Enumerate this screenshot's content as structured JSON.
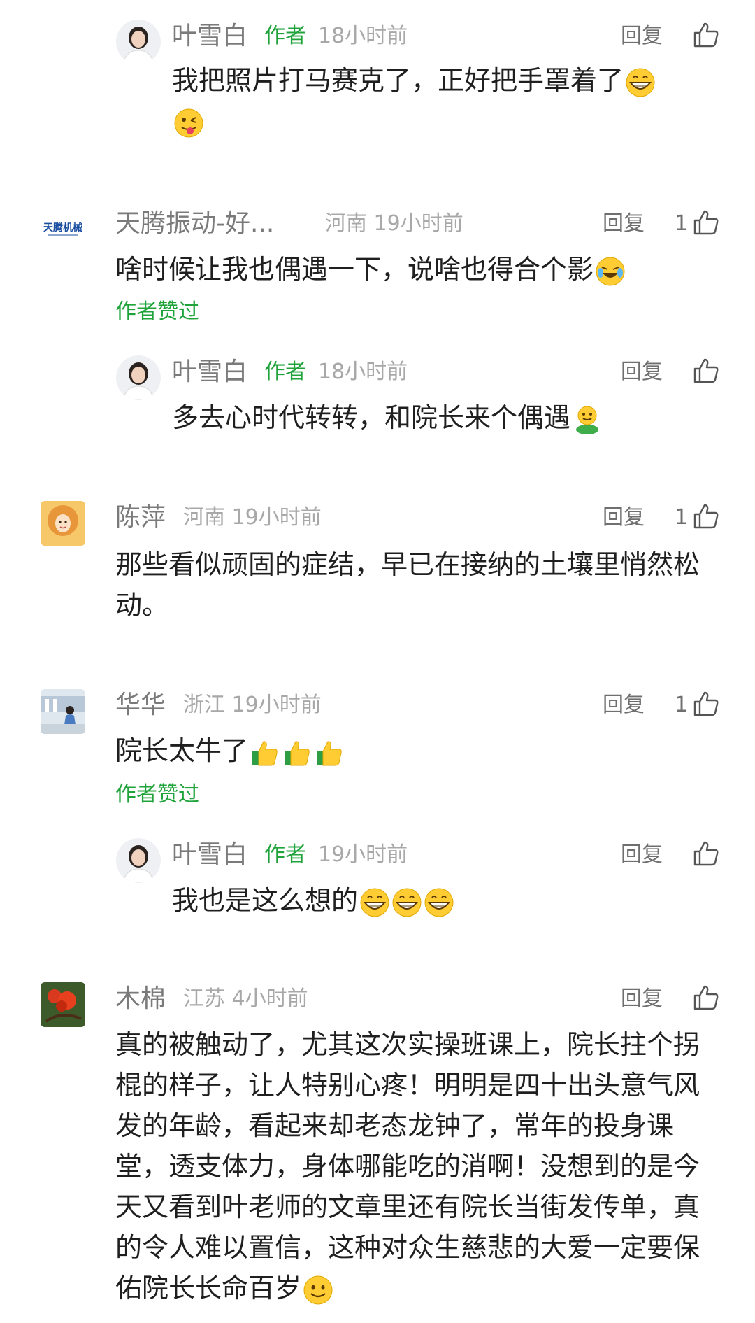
{
  "comments": [
    {
      "name": "叶雪白",
      "author_tag": "作者",
      "meta": "18小时前",
      "reply": "回复",
      "text": "我把照片打马赛克了，正好把手罩着了",
      "emojis": [
        "grin-emoji",
        "wink-tongue-emoji"
      ]
    },
    {
      "name": "天腾振动-好...",
      "meta": "河南 19小时前",
      "reply": "回复",
      "likes": "1",
      "text": "啥时候让我也偶遇一下，说啥也得合个影",
      "emojis": [
        "laugh-cry-emoji"
      ],
      "liked_by_author": "作者赞过"
    },
    {
      "name": "叶雪白",
      "author_tag": "作者",
      "meta": "18小时前",
      "reply": "回复",
      "text": "多去心时代转转，和院长来个偶遇",
      "emojis": [
        "hug-emoji"
      ]
    },
    {
      "name": "陈萍",
      "meta": "河南 19小时前",
      "reply": "回复",
      "likes": "1",
      "text": "那些看似顽固的症结，早已在接纳的土壤里悄然松动。"
    },
    {
      "name": "华华",
      "meta": "浙江 19小时前",
      "reply": "回复",
      "likes": "1",
      "text": "院长太牛了",
      "emojis": [
        "thumbs-up-emoji",
        "thumbs-up-emoji",
        "thumbs-up-emoji"
      ],
      "liked_by_author": "作者赞过"
    },
    {
      "name": "叶雪白",
      "author_tag": "作者",
      "meta": "19小时前",
      "reply": "回复",
      "text": "我也是这么想的",
      "emojis": [
        "grin-emoji",
        "grin-emoji",
        "grin-emoji"
      ]
    },
    {
      "name": "木棉",
      "meta": "江苏 4小时前",
      "reply": "回复",
      "text": "真的被触动了，尤其这次实操班课上，院长拄个拐棍的样子，让人特别心疼！明明是四十出头意气风发的年龄，看起来却老态龙钟了，常年的投身课堂，透支体力，身体哪能吃的消啊！没想到的是今天又看到叶老师的文章里还有院长当街发传单，真的令人难以置信，这种对众生慈悲的大爱一定要保佑院长长命百岁",
      "emojis": [
        "smile-emoji"
      ]
    }
  ],
  "colors": {
    "author_green": "#1fa33a",
    "meta_gray": "#a8a8a8",
    "name_gray": "#7a7a7a"
  }
}
